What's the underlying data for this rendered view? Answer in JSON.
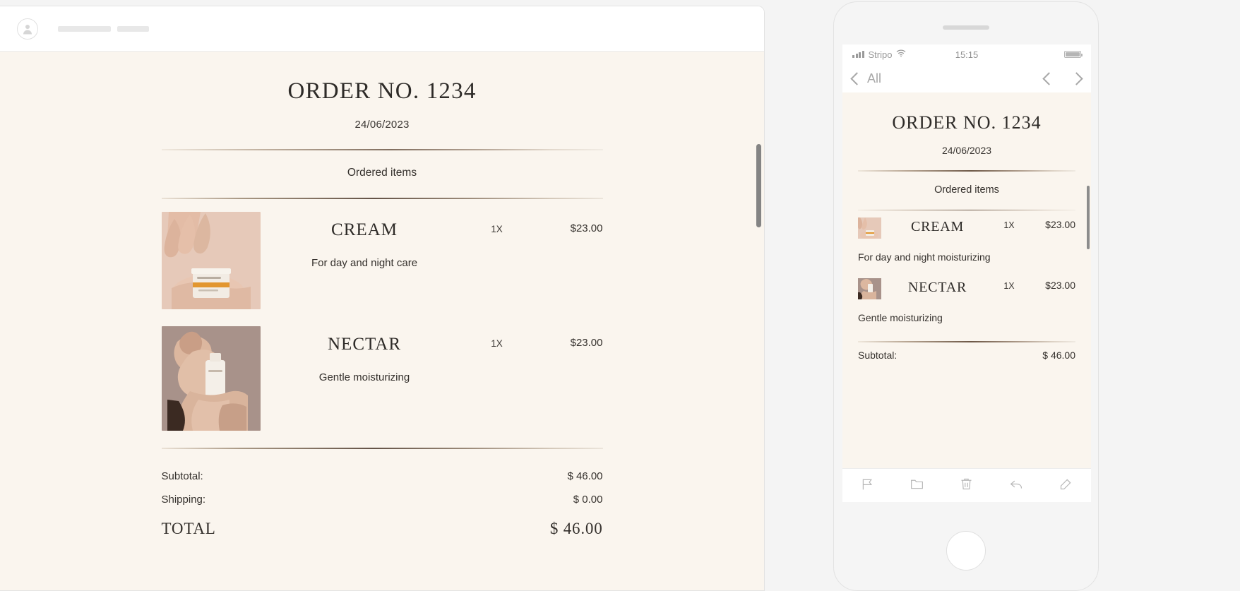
{
  "desktop": {
    "header": {
      "avatar_icon": "user-avatar-icon"
    },
    "email": {
      "order_title": "ORDER NO. 1234",
      "order_date": "24/06/2023",
      "ordered_items_label": "Ordered items",
      "items": [
        {
          "name": "CREAM",
          "description": "For day and night care",
          "quantity": "1X",
          "price": "$23.00",
          "image_alt": "hand-holding-cream-jar"
        },
        {
          "name": "NECTAR",
          "description": "Gentle moisturizing",
          "quantity": "1X",
          "price": "$23.00",
          "image_alt": "hand-holding-serum-bottle"
        }
      ],
      "totals": [
        {
          "label": "Subtotal:",
          "value": "$ 46.00"
        },
        {
          "label": "Shipping:",
          "value": "$ 0.00"
        },
        {
          "label": "TOTAL",
          "value": "$ 46.00"
        }
      ]
    }
  },
  "mobile": {
    "status_bar": {
      "carrier": "Stripo",
      "time": "15:15",
      "signal_icon": "signal-bars-icon",
      "wifi_icon": "wifi-icon",
      "battery_icon": "battery-icon"
    },
    "nav": {
      "back_label": "All",
      "prev_icon": "chevron-left-icon",
      "next_icon": "chevron-right-icon"
    },
    "email": {
      "order_title": "ORDER NO. 1234",
      "order_date": "24/06/2023",
      "ordered_items_label": "Ordered items",
      "items": [
        {
          "name": "CREAM",
          "description": "For day and night moisturizing",
          "quantity": "1X",
          "price": "$23.00"
        },
        {
          "name": "NECTAR",
          "description": "Gentle moisturizing",
          "quantity": "1X",
          "price": "$23.00"
        }
      ],
      "subtotal_label": "Subtotal:",
      "subtotal_value": "$ 46.00"
    },
    "toolbar": [
      {
        "icon": "flag-icon"
      },
      {
        "icon": "folder-icon"
      },
      {
        "icon": "trash-icon"
      },
      {
        "icon": "reply-icon"
      },
      {
        "icon": "compose-icon"
      }
    ]
  },
  "colors": {
    "email_bg": "#faf5ee",
    "text": "#34302c",
    "rule_dark": "#4a372a",
    "thumb_rose": "#e0c3b4",
    "thumb_mauve": "#a8928a"
  }
}
